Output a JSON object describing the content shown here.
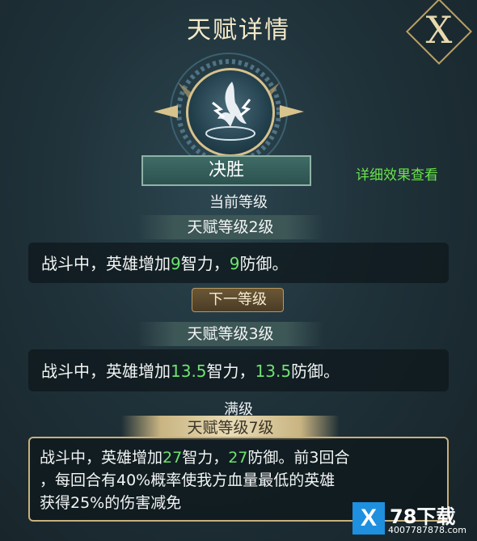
{
  "header": {
    "title": "天赋详情",
    "close_label": "X"
  },
  "skill": {
    "name": "决胜",
    "detail_link": "详细效果查看"
  },
  "current": {
    "section_label": "当前等级",
    "level_label": "天赋等级2级",
    "desc_prefix": "战斗中，英雄增加",
    "int_value": "9",
    "mid": "智力，",
    "def_value": "9",
    "suffix": "防御。"
  },
  "next": {
    "tag": "下一等级",
    "level_label": "天赋等级3级",
    "desc_prefix": "战斗中，英雄增加",
    "int_value": "13.5",
    "mid": "智力，",
    "def_value": "13.5",
    "suffix": "防御。"
  },
  "max": {
    "section_label": "满级",
    "level_label": "天赋等级7级",
    "desc_prefix": "战斗中，英雄增加",
    "int_value": "27",
    "mid": "智力，",
    "def_value": "27",
    "suffix_line1": "防御。前3回合",
    "line2": "，每回合有40%概率使我方血量最低的英雄",
    "line3": "获得25%的伤害减免"
  },
  "watermark": {
    "brand": "78下载",
    "url": "4007787878.com",
    "mark": "X"
  },
  "colors": {
    "accent_green": "#6ee36f",
    "gold": "#c9b07c",
    "teal_plate": "#3f6b66"
  }
}
